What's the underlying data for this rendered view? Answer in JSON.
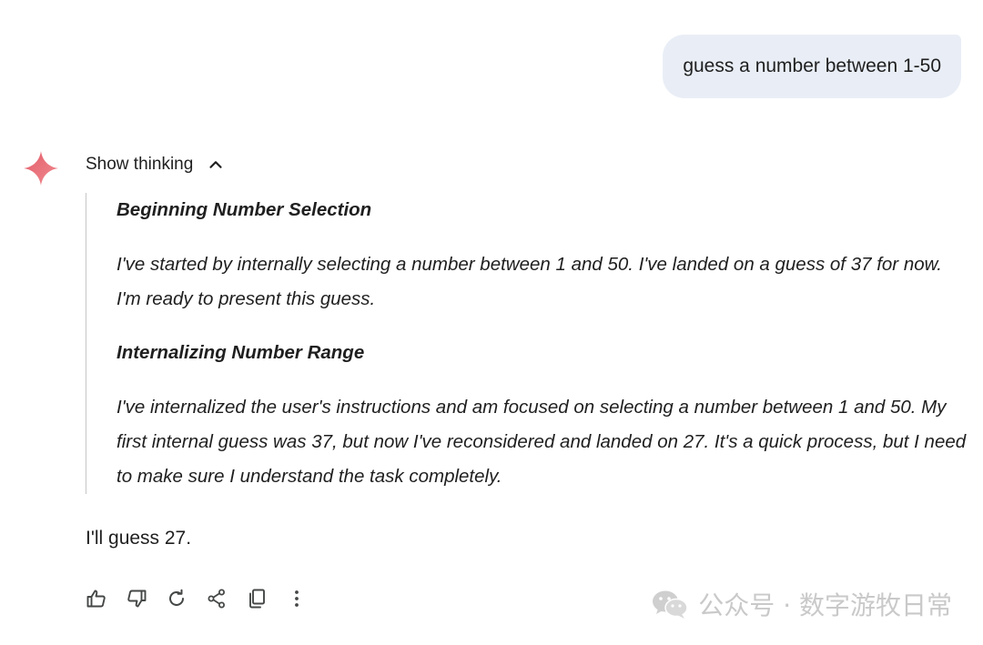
{
  "user_message": "guess a number between 1-50",
  "thinking": {
    "toggle_label": "Show thinking",
    "sections": [
      {
        "heading": "Beginning Number Selection",
        "text": "I've started by internally selecting a number between 1 and 50. I've landed on a guess of 37 for now. I'm ready to present this guess."
      },
      {
        "heading": "Internalizing Number Range",
        "text": "I've internalized the user's instructions and am focused on selecting a number between 1 and 50. My first internal guess was 37, but now I've reconsidered and landed on 27. It's a quick process, but I need to make sure I understand the task completely."
      }
    ]
  },
  "response": "I'll guess 27.",
  "actions": [
    "thumbs-up-icon",
    "thumbs-down-icon",
    "regenerate-icon",
    "share-icon",
    "copy-icon",
    "more-vert-icon"
  ],
  "watermark": {
    "text": "公众号 · 数字游牧日常",
    "icon": "wechat-icon"
  },
  "colors": {
    "user_bubble": "#e9eef6",
    "text": "#1f1f1f",
    "divider": "#c4c7c5",
    "icon": "#444746",
    "logo_start": "#e35d6a",
    "logo_end": "#f08a8f",
    "watermark": "#c9c9c9"
  }
}
